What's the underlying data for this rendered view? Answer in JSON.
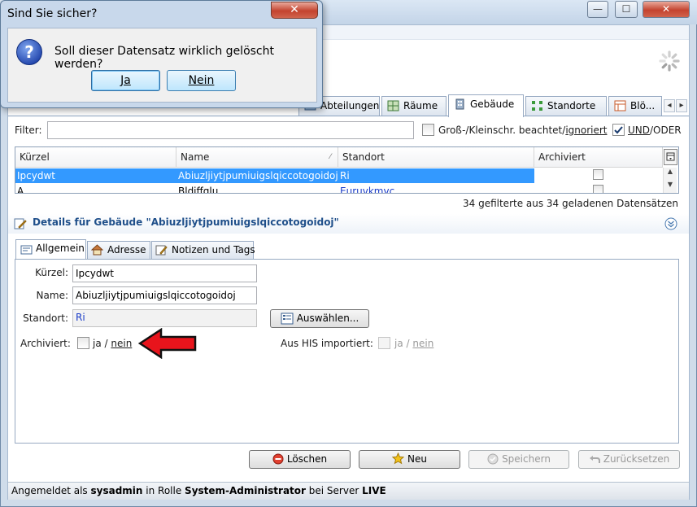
{
  "window": {
    "minimize_glyph": "—",
    "maximize_glyph": "☐",
    "close_glyph": "✕"
  },
  "tabs": [
    {
      "label": "Abteilungen",
      "icon": "department-icon"
    },
    {
      "label": "Räume",
      "icon": "room-icon"
    },
    {
      "label": "Gebäude",
      "icon": "building-icon",
      "active": true
    },
    {
      "label": "Standorte",
      "icon": "location-icon"
    },
    {
      "label": "Blö...",
      "icon": "block-icon"
    }
  ],
  "filter": {
    "label": "Filter:",
    "value": "",
    "case_label_prefix": "Groß-/Kleinschr. beachtet/",
    "case_label_link": "ignoriert",
    "andor_label_prefix": "UND",
    "andor_label_suffix": "/ODER",
    "andor_checked": true
  },
  "table": {
    "columns": [
      "Kürzel",
      "Name",
      "Standort",
      "Archiviert"
    ],
    "rows": [
      {
        "kuerzel": "Ipcydwt",
        "name": "Abiuzljiytjpumiuigslqiccotogoidoj",
        "standort": "Ri",
        "archiviert": false
      },
      {
        "kuerzel": "A",
        "name": "Bldiffqlu",
        "standort": "Euruvkmvc",
        "archiviert": false
      }
    ],
    "count_text": "34 gefilterte aus 34 geladenen Datensätzen"
  },
  "details": {
    "title": "Details für Gebäude \"Abiuzljiytjpumiuigslqiccotogoidoj\"",
    "subtabs": [
      "Allgemein",
      "Adresse",
      "Notizen und Tags"
    ],
    "kuerzel_label": "Kürzel:",
    "kuerzel_value": "Ipcydwt",
    "name_label": "Name:",
    "name_value": "Abiuzljiytjpumiuigslqiccotogoidoj",
    "standort_label": "Standort:",
    "standort_value": "Ri",
    "select_button": "Auswählen...",
    "archiviert_label": "Archiviert:",
    "ja": "ja",
    "slash": "/",
    "nein": "nein",
    "his_label": "Aus HIS importiert:"
  },
  "buttons": {
    "delete": "Löschen",
    "new": "Neu",
    "save": "Speichern",
    "reset": "Zurücksetzen"
  },
  "status": {
    "prefix": "Angemeldet als ",
    "user": "sysadmin",
    "middle": " in Rolle ",
    "role": "System-Administrator",
    "server_text": " bei Server ",
    "server": "LIVE"
  },
  "dialog": {
    "title": "Sind Sie sicher?",
    "message": "Soll dieser Datensatz wirklich gelöscht werden?",
    "yes": "Ja",
    "no": "Nein",
    "close_glyph": "✕"
  }
}
